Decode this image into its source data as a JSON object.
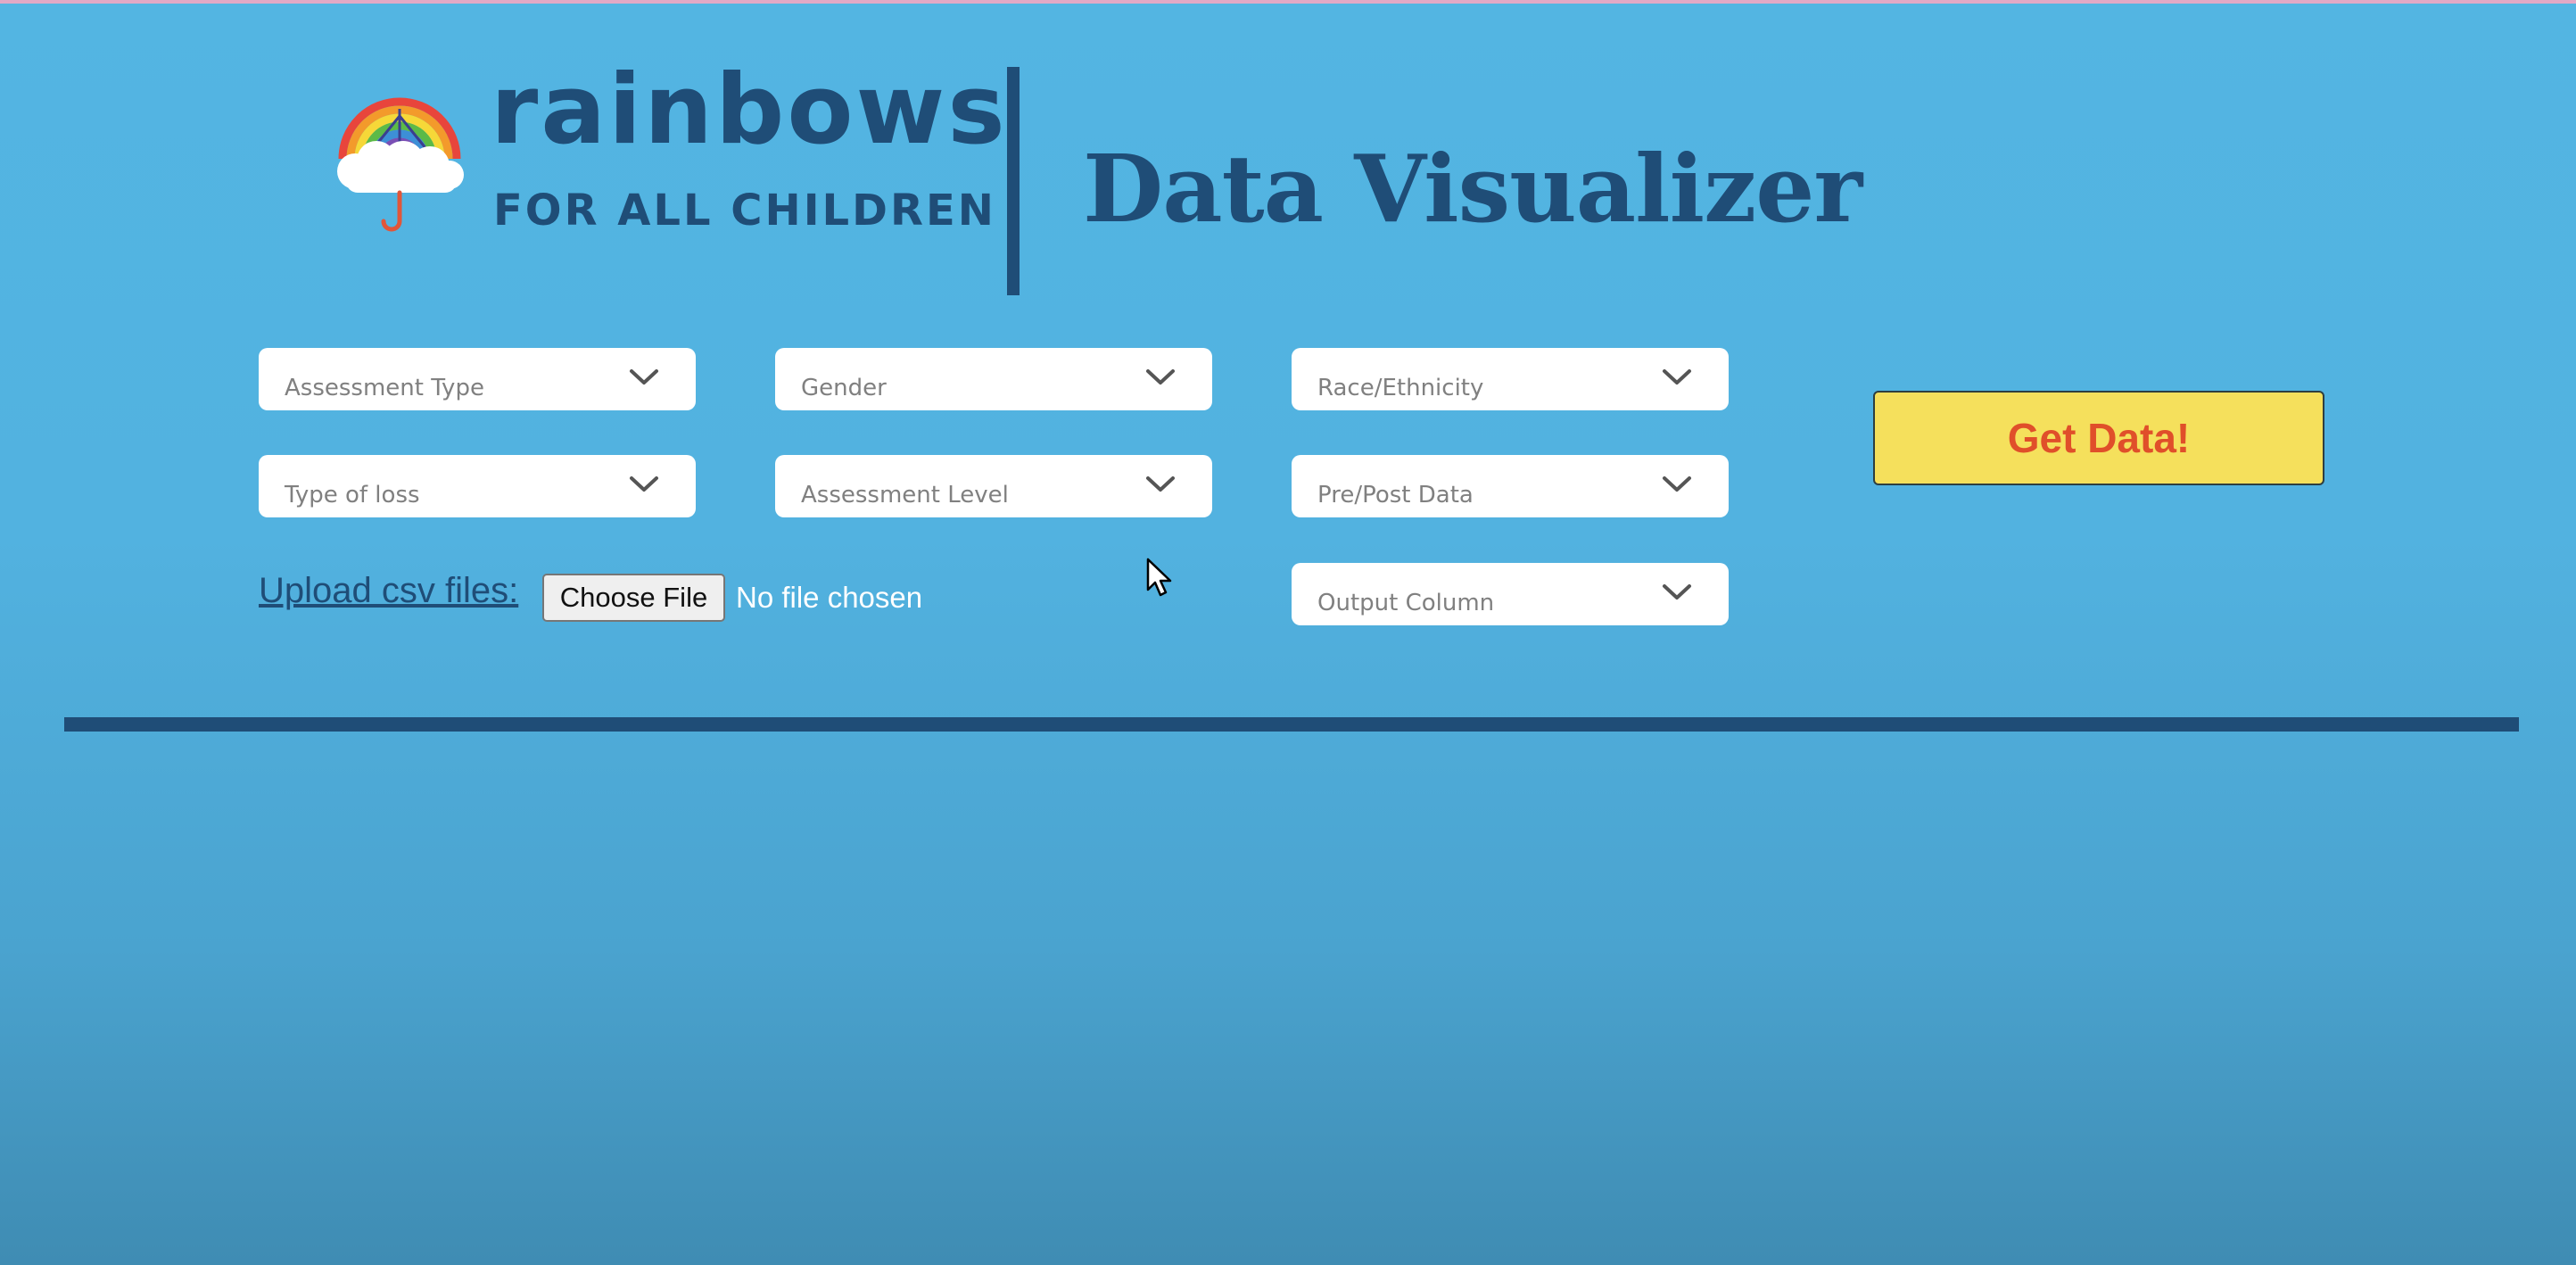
{
  "brand": {
    "name": "rainbows",
    "tagline": "FOR ALL CHILDREN",
    "logo_icon": "rainbow-umbrella-cloud-icon"
  },
  "app": {
    "title": "Data Visualizer"
  },
  "filters": {
    "assessment_type": {
      "placeholder": "Assessment Type"
    },
    "gender": {
      "placeholder": "Gender"
    },
    "race_ethnicity": {
      "placeholder": "Race/Ethnicity"
    },
    "type_of_loss": {
      "placeholder": "Type of loss"
    },
    "assessment_level": {
      "placeholder": "Assessment Level"
    },
    "pre_post_data": {
      "placeholder": "Pre/Post Data"
    },
    "output_column": {
      "placeholder": "Output Column"
    }
  },
  "upload": {
    "label": "Upload csv files:",
    "button_label": "Choose File",
    "status": "No file chosen"
  },
  "actions": {
    "get_data_label": "Get Data!"
  },
  "colors": {
    "background": "#53b5e2",
    "brand_navy": "#1f4d77",
    "button_yellow": "#f5e05c",
    "button_text": "#e04f2a"
  },
  "icons": {
    "dropdown": "chevron-down-icon",
    "pointer": "mouse-cursor-icon"
  }
}
